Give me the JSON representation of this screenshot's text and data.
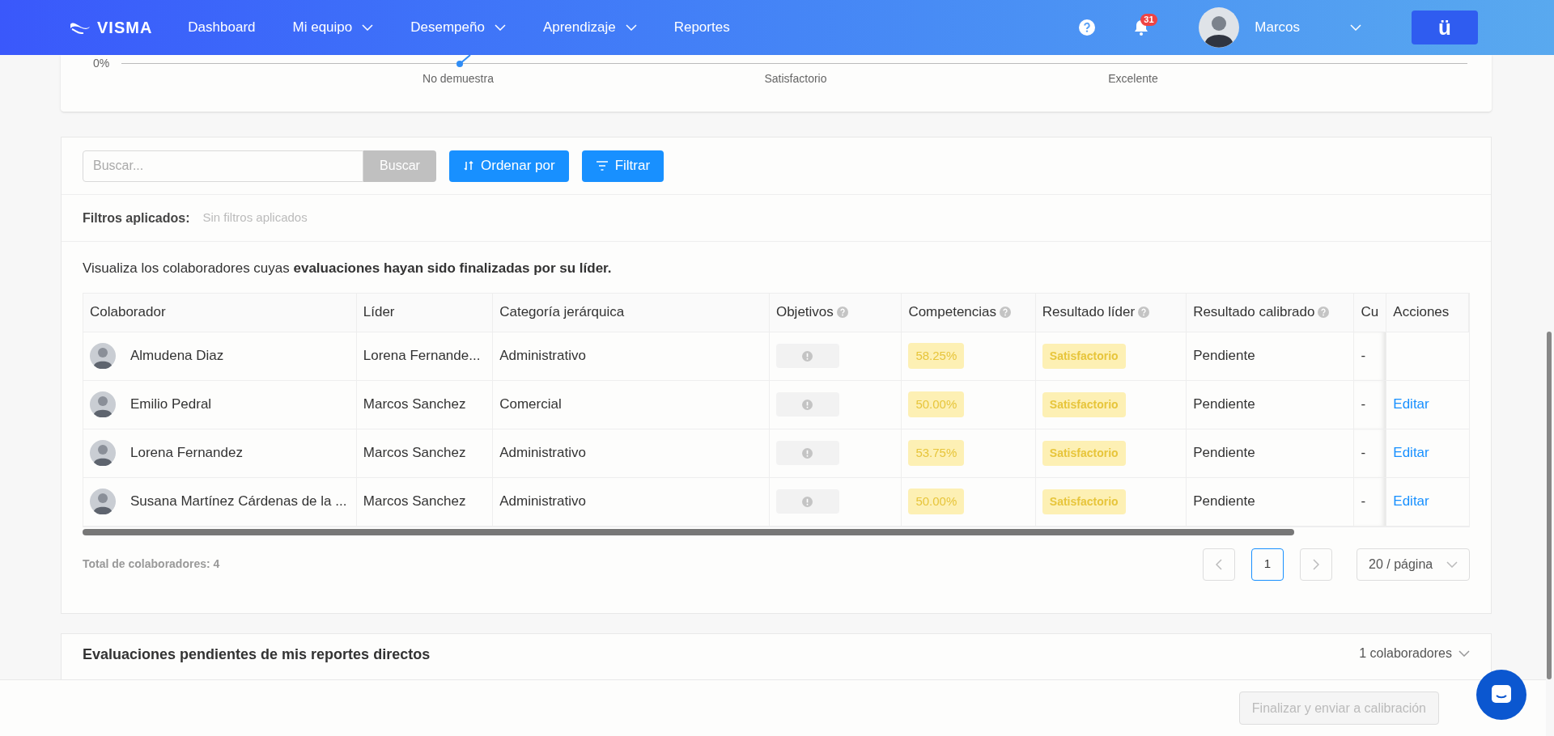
{
  "header": {
    "logo": "VISMA",
    "nav": [
      {
        "label": "Dashboard",
        "dropdown": false
      },
      {
        "label": "Mi equipo",
        "dropdown": true
      },
      {
        "label": "Desempeño",
        "dropdown": true
      },
      {
        "label": "Aprendizaje",
        "dropdown": true
      },
      {
        "label": "Reportes",
        "dropdown": false
      }
    ],
    "notifications": "31",
    "user": "Marcos",
    "app_button": "ü"
  },
  "chart": {
    "y_label": "0%",
    "x_labels": [
      "No demuestra",
      "Satisfactorio",
      "Excelente"
    ]
  },
  "toolbar": {
    "search_placeholder": "Buscar...",
    "search_button": "Buscar",
    "sort_button": "Ordenar por",
    "filter_button": "Filtrar"
  },
  "filters": {
    "label": "Filtros aplicados:",
    "value": "Sin filtros aplicados"
  },
  "description": "Visualiza los colaboradores cuyas **evaluaciones hayan sido finalizadas por su líder.**",
  "table": {
    "columns": [
      {
        "label": "Colaborador",
        "help": false
      },
      {
        "label": "Líder",
        "help": false
      },
      {
        "label": "Categoría jerárquica",
        "help": false
      },
      {
        "label": "Objetivos",
        "help": true
      },
      {
        "label": "Competencias",
        "help": true
      },
      {
        "label": "Resultado líder",
        "help": true
      },
      {
        "label": "Resultado calibrado",
        "help": true
      },
      {
        "label": "Cu",
        "help": false
      },
      {
        "label": "Acciones",
        "help": false
      }
    ],
    "rows": [
      {
        "name": "Almudena Diaz",
        "leader": "Lorena Fernande...",
        "category": "Administrativo",
        "competencias": "58.25%",
        "resultado_lider": "Satisfactorio",
        "resultado_calibrado": "Pendiente",
        "column_8": "-"
      },
      {
        "name": "Emilio Pedral",
        "leader": "Marcos Sanchez",
        "category": "Comercial",
        "competencias": "50.00%",
        "resultado_lider": "Satisfactorio",
        "resultado_calibrado": "Pendiente",
        "column_8": "-",
        "action": "Editar"
      },
      {
        "name": "Lorena Fernandez",
        "leader": "Marcos Sanchez",
        "category": "Administrativo",
        "competencias": "53.75%",
        "resultado_lider": "Satisfactorio",
        "resultado_calibrado": "Pendiente",
        "column_8": "-",
        "action": "Editar"
      },
      {
        "name": "Susana Martínez Cárdenas de la ...",
        "leader": "Marcos Sanchez",
        "category": "Administrativo",
        "competencias": "50.00%",
        "resultado_lider": "Satisfactorio",
        "resultado_calibrado": "Pendiente",
        "column_8": "-",
        "action": "Editar"
      }
    ]
  },
  "total": "Total de colaboradores: 4",
  "pagination": {
    "pages": [
      {
        "label": "1",
        "selected": true
      }
    ],
    "page_size": "20 / página"
  },
  "pending": {
    "title": "Evaluaciones pendientes de mis reportes directos",
    "count": "1 colaboradores"
  },
  "footer": {
    "button": "Finalizar y enviar a calibración",
    "disabled": true
  }
}
